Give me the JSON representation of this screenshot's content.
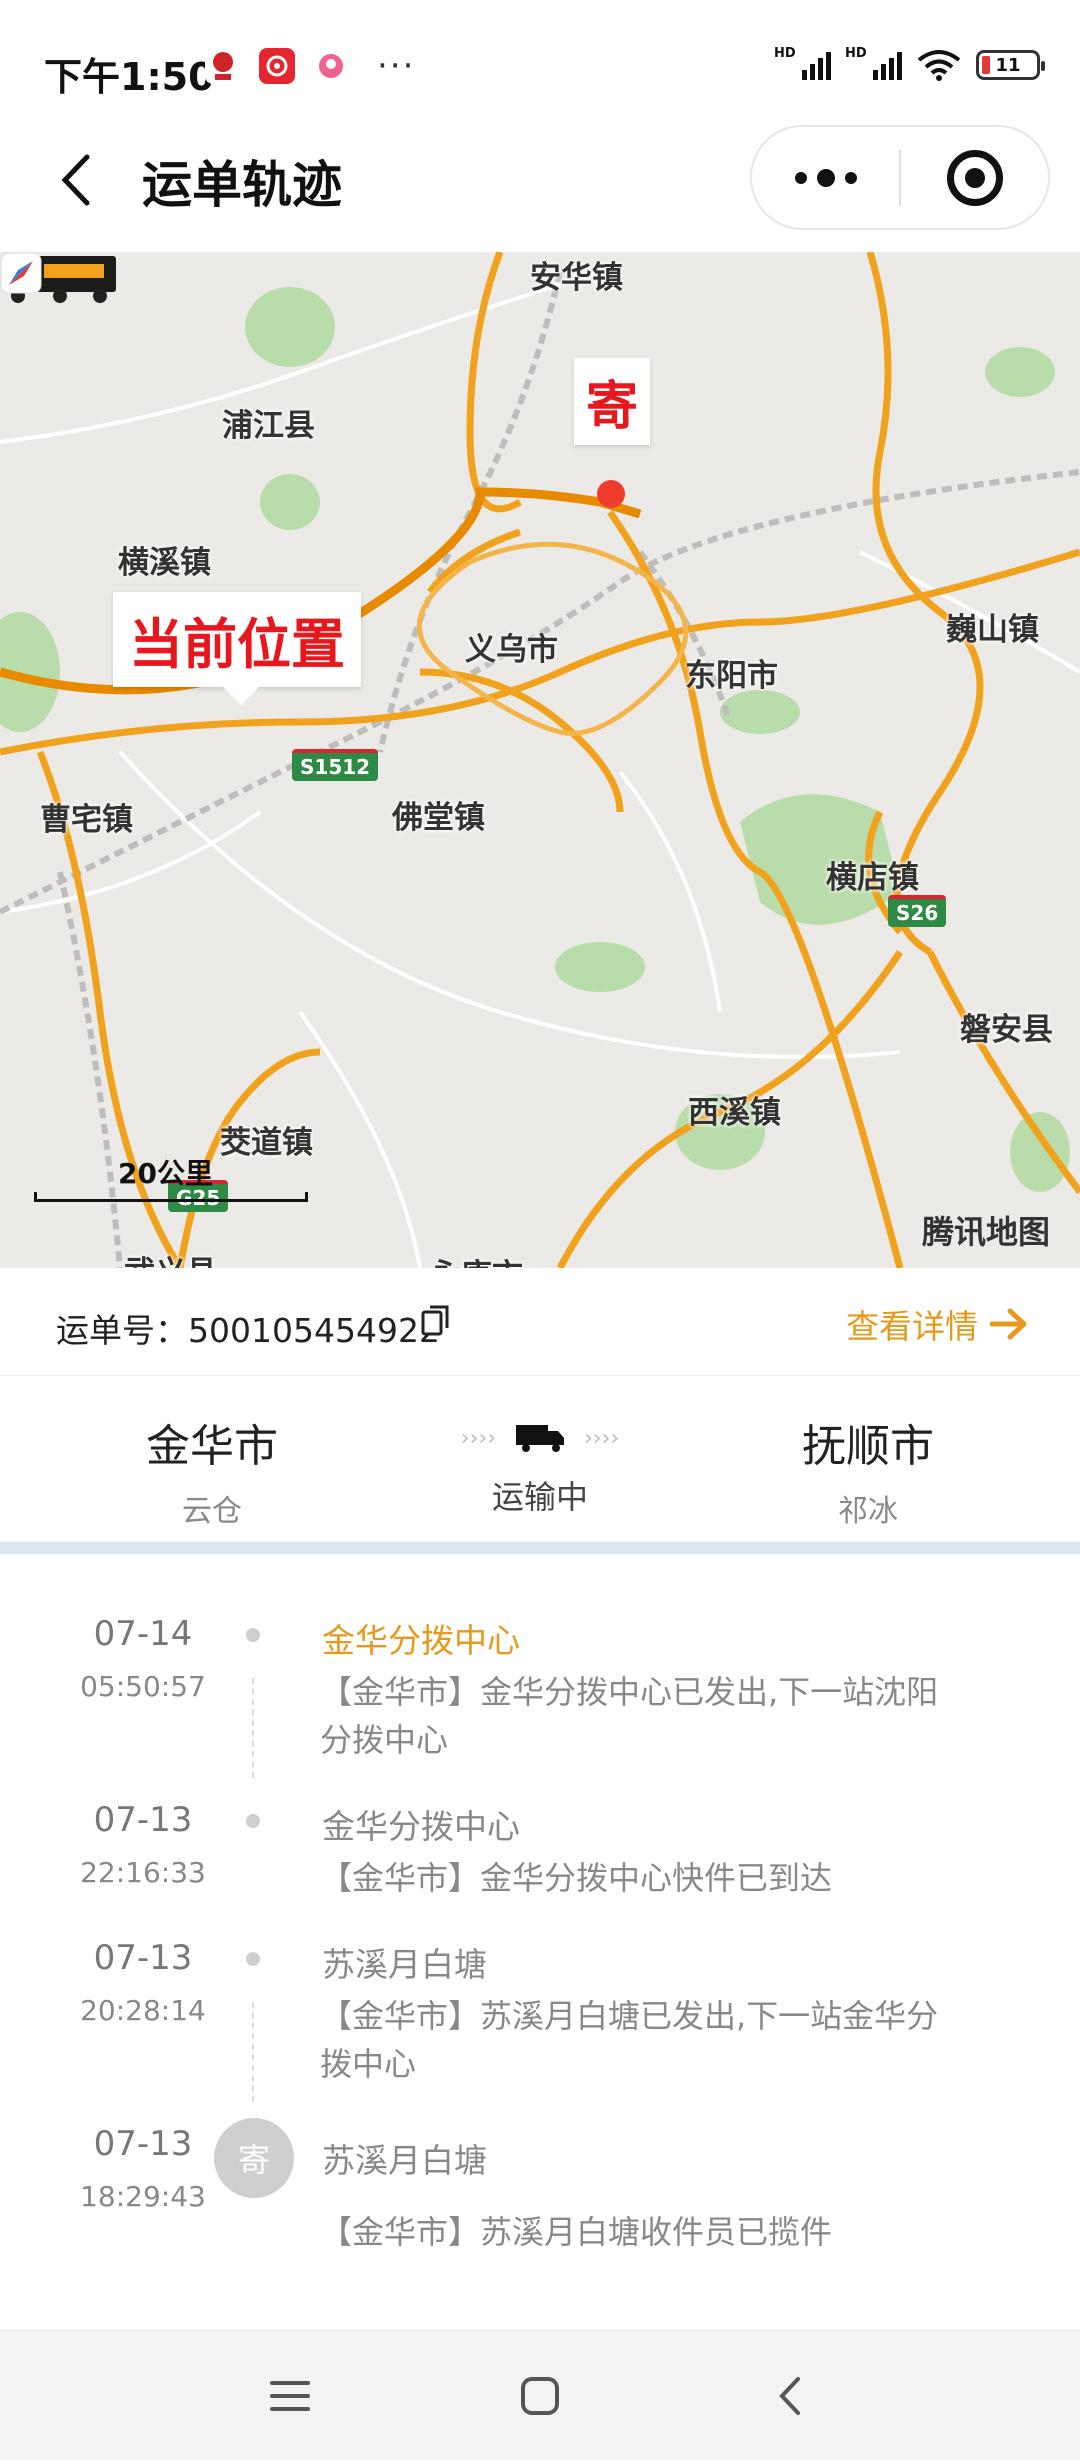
{
  "status_bar": {
    "time": "下午1:50",
    "more": "···",
    "signal_label": "HD",
    "battery_level": "11"
  },
  "header": {
    "title": "运单轨迹"
  },
  "map": {
    "places": [
      "安华镇",
      "浦江县",
      "横溪镇",
      "义乌市",
      "东阳市",
      "巍山镇",
      "曹宅镇",
      "佛堂镇",
      "横店镇",
      "磐安县",
      "西溪镇",
      "茭道镇",
      "武义县",
      "永康市"
    ],
    "current_label": "当前位置",
    "send_label": "寄",
    "road_badges": [
      "S1512",
      "S26",
      "G25"
    ],
    "scale": "20公里",
    "provider": "腾讯地图",
    "colors": {
      "main_road": "#f0a21c",
      "route": "#e88a00",
      "marker": "#f03c2c"
    }
  },
  "waybill": {
    "label": "运单号：",
    "number": "500105454922",
    "detail_link": "查看详情"
  },
  "route": {
    "origin": {
      "city": "金华市",
      "sub": "云仓"
    },
    "status": "运输中",
    "destination": {
      "city": "抚顺市",
      "sub": "祁冰"
    }
  },
  "timeline": [
    {
      "date": "07-14",
      "time": "05:50:57",
      "title": "金华分拨中心",
      "desc": "【金华市】金华分拨中心已发出,下一站沈阳分拨中心",
      "active": true
    },
    {
      "date": "07-13",
      "time": "22:16:33",
      "title": "金华分拨中心",
      "desc": "【金华市】金华分拨中心快件已到达",
      "active": false
    },
    {
      "date": "07-13",
      "time": "20:28:14",
      "title": "苏溪月白塘",
      "desc": "【金华市】苏溪月白塘已发出,下一站金华分拨中心",
      "active": false
    },
    {
      "date": "07-13",
      "time": "18:29:43",
      "title": "苏溪月白塘",
      "desc": "【金华市】苏溪月白塘收件员已揽件",
      "active": false,
      "badge": "寄"
    }
  ]
}
